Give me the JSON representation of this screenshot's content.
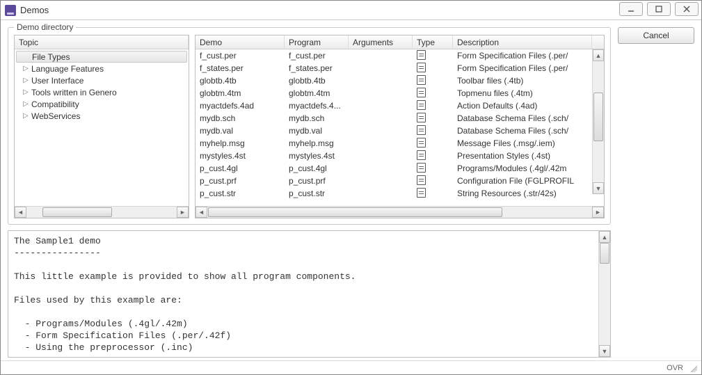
{
  "window": {
    "title": "Demos"
  },
  "groupbox": {
    "title": "Demo directory"
  },
  "tree": {
    "header": "Topic",
    "items": [
      {
        "label": "File Types",
        "expander": "",
        "selected": true
      },
      {
        "label": "Language Features",
        "expander": "▷",
        "selected": false
      },
      {
        "label": "User Interface",
        "expander": "▷",
        "selected": false
      },
      {
        "label": "Tools written in Genero",
        "expander": "▷",
        "selected": false
      },
      {
        "label": "Compatibility",
        "expander": "▷",
        "selected": false
      },
      {
        "label": "WebServices",
        "expander": "▷",
        "selected": false
      }
    ]
  },
  "grid": {
    "headers": {
      "demo": "Demo",
      "program": "Program",
      "arguments": "Arguments",
      "type": "Type",
      "description": "Description"
    },
    "rows": [
      {
        "demo": "f_cust.per",
        "program": "f_cust.per",
        "arguments": "",
        "description": "Form Specification Files (.per/"
      },
      {
        "demo": "f_states.per",
        "program": "f_states.per",
        "arguments": "",
        "description": "Form Specification Files (.per/"
      },
      {
        "demo": "globtb.4tb",
        "program": "globtb.4tb",
        "arguments": "",
        "description": "Toolbar files (.4tb)"
      },
      {
        "demo": "globtm.4tm",
        "program": "globtm.4tm",
        "arguments": "",
        "description": "Topmenu files (.4tm)"
      },
      {
        "demo": "myactdefs.4ad",
        "program": "myactdefs.4...",
        "arguments": "",
        "description": "Action Defaults (.4ad)"
      },
      {
        "demo": "mydb.sch",
        "program": "mydb.sch",
        "arguments": "",
        "description": "Database Schema Files (.sch/"
      },
      {
        "demo": "mydb.val",
        "program": "mydb.val",
        "arguments": "",
        "description": "Database Schema Files (.sch/"
      },
      {
        "demo": "myhelp.msg",
        "program": "myhelp.msg",
        "arguments": "",
        "description": "Message Files (.msg/.iem)"
      },
      {
        "demo": "mystyles.4st",
        "program": "mystyles.4st",
        "arguments": "",
        "description": "Presentation Styles (.4st)"
      },
      {
        "demo": "p_cust.4gl",
        "program": "p_cust.4gl",
        "arguments": "",
        "description": "Programs/Modules (.4gl/.42m"
      },
      {
        "demo": "p_cust.prf",
        "program": "p_cust.prf",
        "arguments": "",
        "description": "Configuration File (FGLPROFIL"
      },
      {
        "demo": "p_cust.str",
        "program": "p_cust.str",
        "arguments": "",
        "description": "String Resources (.str/42s)"
      }
    ]
  },
  "info": {
    "text": "The Sample1 demo\n----------------\n\nThis little example is provided to show all program components.\n\nFiles used by this example are:\n\n  - Programs/Modules (.4gl/.42m)\n  - Form Specification Files (.per/.42f)\n  - Using the preprocessor (.inc)"
  },
  "buttons": {
    "cancel": "Cancel"
  },
  "status": {
    "ovr": "OVR"
  }
}
